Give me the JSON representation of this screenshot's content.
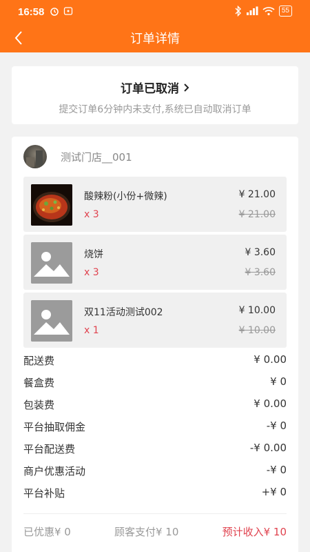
{
  "status_bar": {
    "time": "16:58",
    "battery": "55"
  },
  "header": {
    "title": "订单详情"
  },
  "order_status": {
    "title": "订单已取消",
    "description": "提交订单6分钟内未支付,系统已自动取消订单"
  },
  "shop": {
    "name": "测试门店__001"
  },
  "items": [
    {
      "name": "酸辣粉(小份+微辣)",
      "qty": "x 3",
      "price": "¥ 21.00",
      "original_price": "¥ 21.00"
    },
    {
      "name": "烧饼",
      "qty": "x 3",
      "price": "¥ 3.60",
      "original_price": "¥ 3.60"
    },
    {
      "name": "双11活动测试002",
      "qty": "x 1",
      "price": "¥ 10.00",
      "original_price": "¥ 10.00"
    }
  ],
  "fees": [
    {
      "label": "配送费",
      "value": "¥ 0.00"
    },
    {
      "label": "餐盒费",
      "value": "¥ 0"
    },
    {
      "label": "包装费",
      "value": "¥ 0.00"
    },
    {
      "label": "平台抽取佣金",
      "value": "-¥ 0"
    },
    {
      "label": "平台配送费",
      "value": "-¥ 0.00"
    },
    {
      "label": "商户优惠活动",
      "value": "-¥ 0"
    },
    {
      "label": "平台补贴",
      "value": "+¥ 0"
    }
  ],
  "summary": {
    "discount": "已优惠¥ 0",
    "customer_paid": "顾客支付¥ 10",
    "expected_income": "预计收入¥ 10"
  },
  "colors": {
    "brand": "#ff7417",
    "accent_red": "#e0424e"
  }
}
